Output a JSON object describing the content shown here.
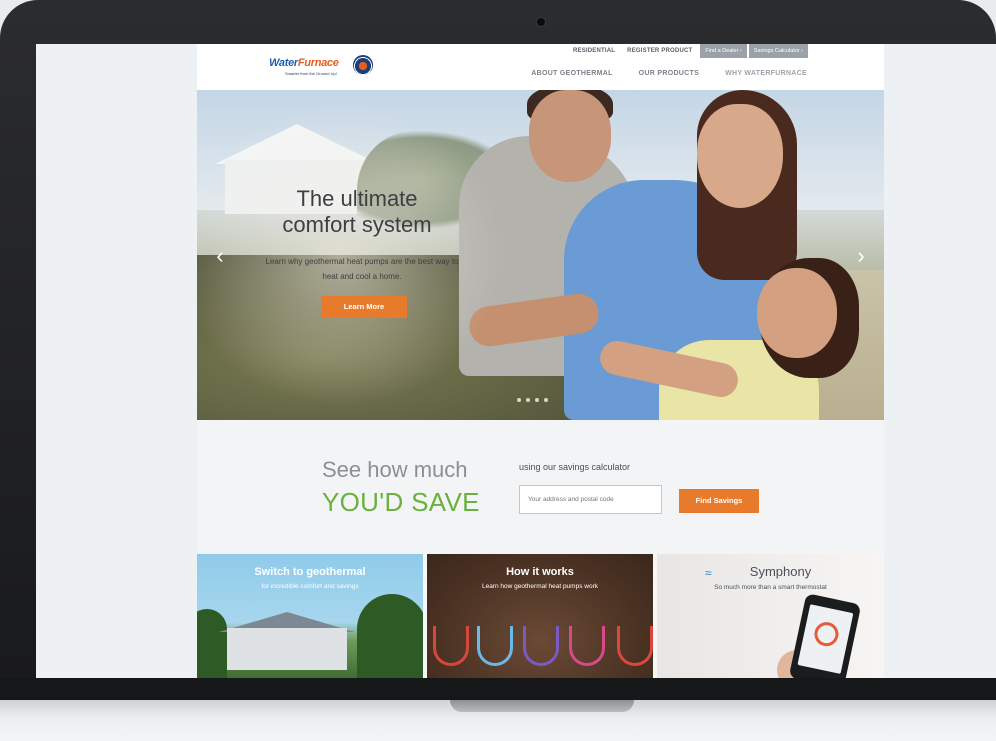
{
  "brand": {
    "logo_part1": "Water",
    "logo_part2": "Furnace",
    "tagline": "Smarter from the Ground Up!"
  },
  "utility_nav": {
    "links": [
      "RESIDENTIAL",
      "REGISTER PRODUCT"
    ],
    "buttons": [
      "Find a Dealer  ›",
      "Savings Calculator  ›"
    ]
  },
  "main_nav": [
    "ABOUT GEOTHERMAL",
    "OUR PRODUCTS",
    "WHY WATERFURNACE"
  ],
  "hero": {
    "title": "The ultimate comfort system",
    "subtitle": "Learn why geothermal heat pumps are the best way to heat and cool a home.",
    "cta": "Learn More",
    "prev_arrow": "‹",
    "next_arrow": "›",
    "slides": 4
  },
  "savings": {
    "headline": "See how much",
    "highlight": "YOU'D SAVE",
    "label": "using our savings calculator",
    "input_placeholder": "Your address and postal code",
    "button": "Find Savings"
  },
  "tiles": [
    {
      "title": "Switch to geothermal",
      "subtitle": "for incredible comfort and savings"
    },
    {
      "title": "How it works",
      "subtitle": "Learn how geothermal heat pumps work"
    },
    {
      "title": "Symphony",
      "subtitle": "So much more than a smart thermostat"
    }
  ],
  "colors": {
    "accent_orange": "#e87a2c",
    "save_green": "#6ab23d",
    "input_border": "#9ed3ec"
  }
}
